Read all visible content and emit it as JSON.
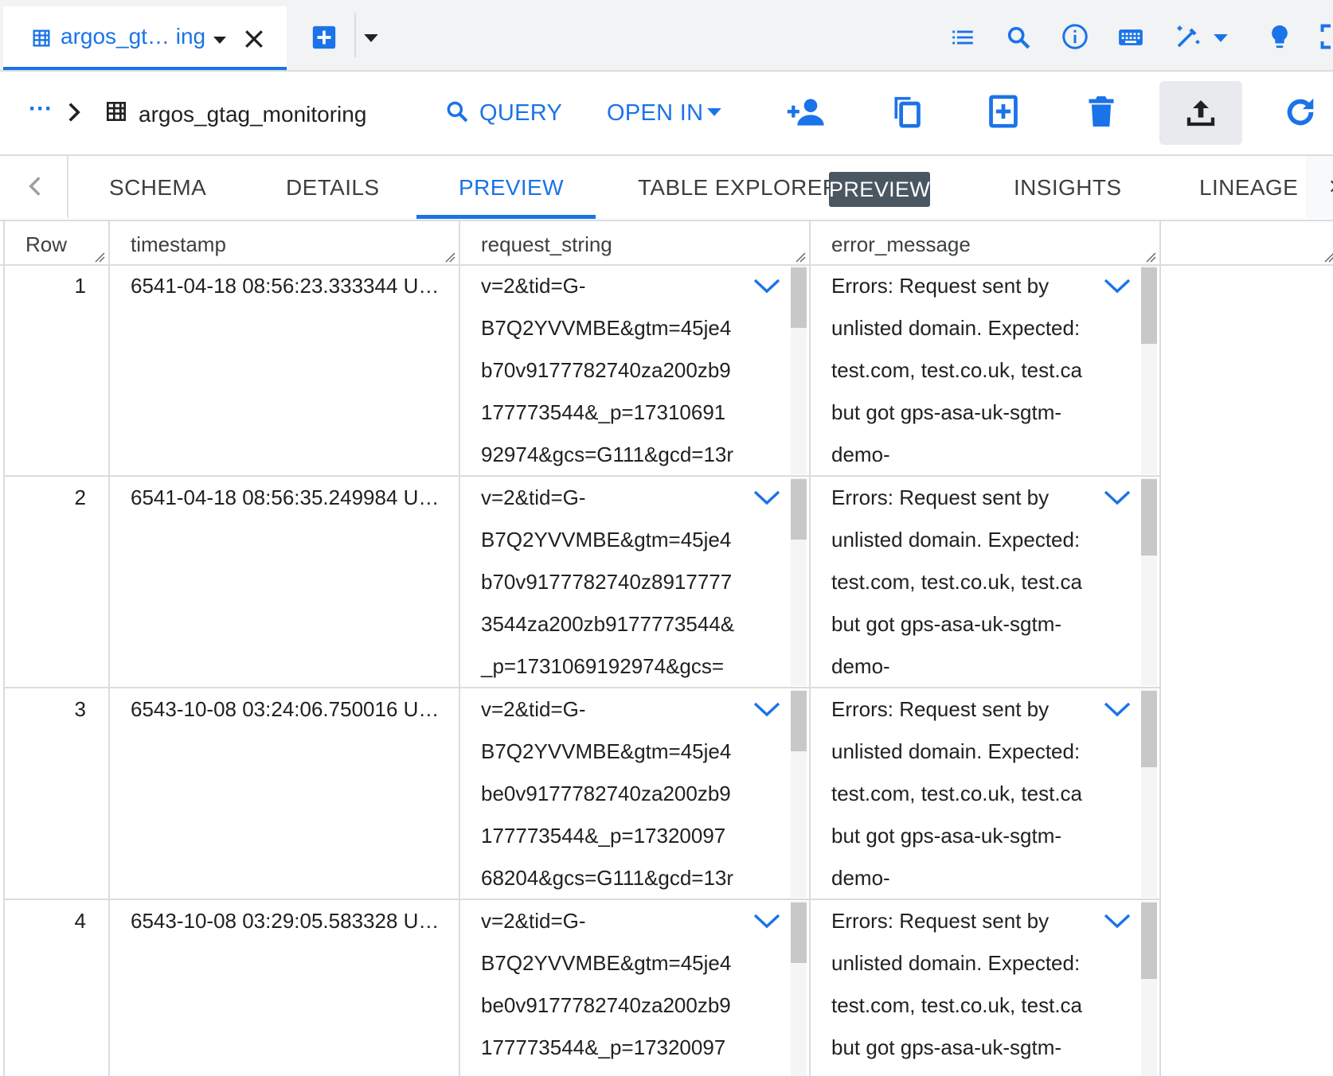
{
  "tab": {
    "title": "argos_gt… ing"
  },
  "breadcrumb": {
    "more": "···",
    "table_name": "argos_gtag_monitoring"
  },
  "toolbar": {
    "query_label": "QUERY",
    "open_in_label": "OPEN IN"
  },
  "subtabs": {
    "schema": "SCHEMA",
    "details": "DETAILS",
    "preview": "PREVIEW",
    "table_explorer": "TABLE EXPLORER",
    "table_explorer_badge": "PREVIEW",
    "insights": "INSIGHTS",
    "lineage": "LINEAGE"
  },
  "columns": [
    "Row",
    "timestamp",
    "request_string",
    "error_message"
  ],
  "rows": [
    {
      "row": "1",
      "timestamp": "6541-04-18 08:56:23.333344 U…",
      "request_lines": [
        "v=2&tid=G-",
        "B7Q2YVVMBE&gtm=45je4",
        "b70v9177782740za200zb9",
        "177773544&_p=17310691",
        "92974&gcs=G111&gcd=13r"
      ],
      "error_lines": [
        "Errors: Request sent by",
        "unlisted domain. Expected:",
        "test.com, test.co.uk, test.ca",
        "but got gps-asa-uk-sgtm-",
        "demo-"
      ]
    },
    {
      "row": "2",
      "timestamp": "6541-04-18 08:56:35.249984 U…",
      "request_lines": [
        "v=2&tid=G-",
        "B7Q2YVVMBE&gtm=45je4",
        "b70v9177782740z8917777",
        "3544za200zb9177773544&",
        "_p=1731069192974&gcs="
      ],
      "error_lines": [
        "Errors: Request sent by",
        "unlisted domain. Expected:",
        "test.com, test.co.uk, test.ca",
        "but got gps-asa-uk-sgtm-",
        "demo-"
      ]
    },
    {
      "row": "3",
      "timestamp": "6543-10-08 03:24:06.750016 U…",
      "request_lines": [
        "v=2&tid=G-",
        "B7Q2YVVMBE&gtm=45je4",
        "be0v9177782740za200zb9",
        "177773544&_p=17320097",
        "68204&gcs=G111&gcd=13r"
      ],
      "error_lines": [
        "Errors: Request sent by",
        "unlisted domain. Expected:",
        "test.com, test.co.uk, test.ca",
        "but got gps-asa-uk-sgtm-",
        "demo-"
      ]
    },
    {
      "row": "4",
      "timestamp": "6543-10-08 03:29:05.583328 U…",
      "request_lines": [
        "v=2&tid=G-",
        "B7Q2YVVMBE&gtm=45je4",
        "be0v9177782740za200zb9",
        "177773544&_p=17320097"
      ],
      "error_lines": [
        "Errors: Request sent by",
        "unlisted domain. Expected:",
        "test.com, test.co.uk, test.ca",
        "but got gps-asa-uk-sgtm-"
      ]
    }
  ],
  "colors": {
    "accent": "#1a73e8",
    "badge": "#4a5660",
    "border": "#dadce0"
  }
}
